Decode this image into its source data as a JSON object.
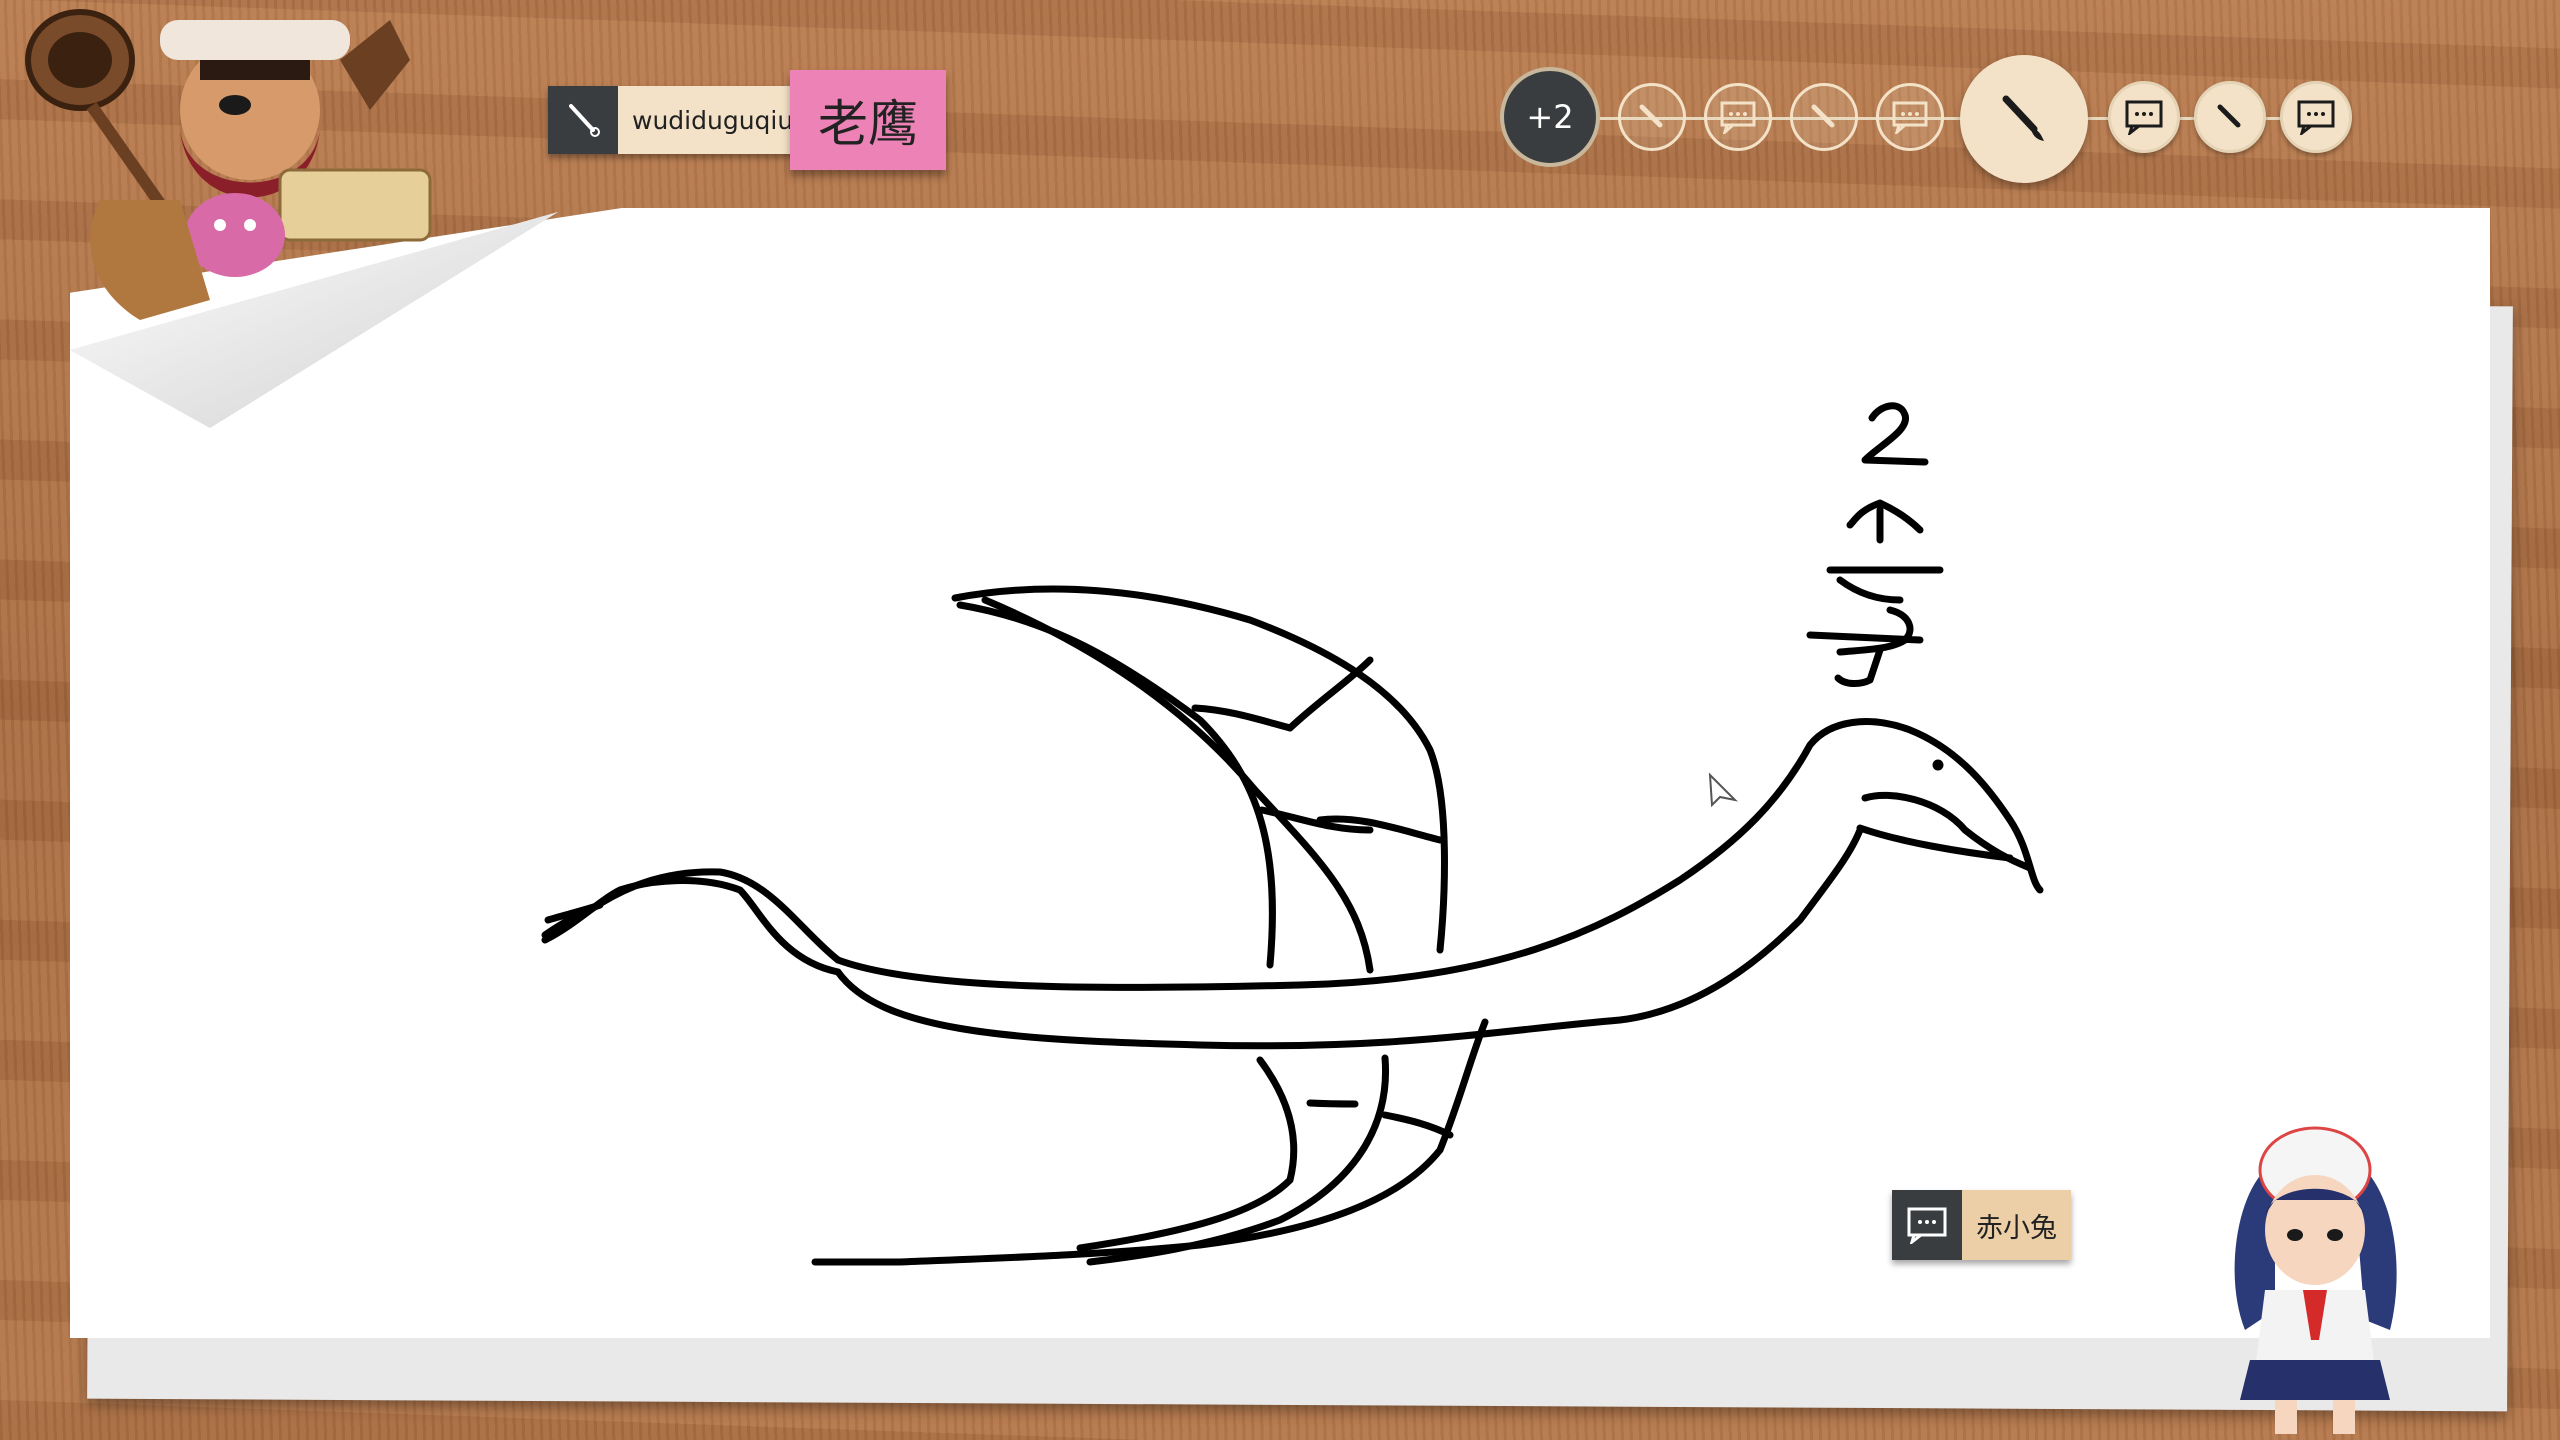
{
  "drawer": {
    "name": "wudiduguqiu",
    "icon": "brush-icon"
  },
  "prompt_word": "老鹰",
  "timeline": {
    "extra_count": "+2",
    "steps": [
      {
        "type": "draw",
        "state": "past"
      },
      {
        "type": "guess",
        "state": "past"
      },
      {
        "type": "draw",
        "state": "past"
      },
      {
        "type": "guess",
        "state": "past"
      },
      {
        "type": "draw",
        "state": "current"
      },
      {
        "type": "guess",
        "state": "upcoming"
      },
      {
        "type": "draw",
        "state": "upcoming"
      },
      {
        "type": "guess",
        "state": "upcoming"
      }
    ]
  },
  "guesser": {
    "name": "赤小兔",
    "icon": "chat-bubble-icon"
  },
  "drawing_note": [
    "2",
    "个",
    "字"
  ],
  "colors": {
    "dark": "#3a3d40",
    "cream": "#f3e2c7",
    "pink": "#ec82b6",
    "ink": "#000000"
  }
}
